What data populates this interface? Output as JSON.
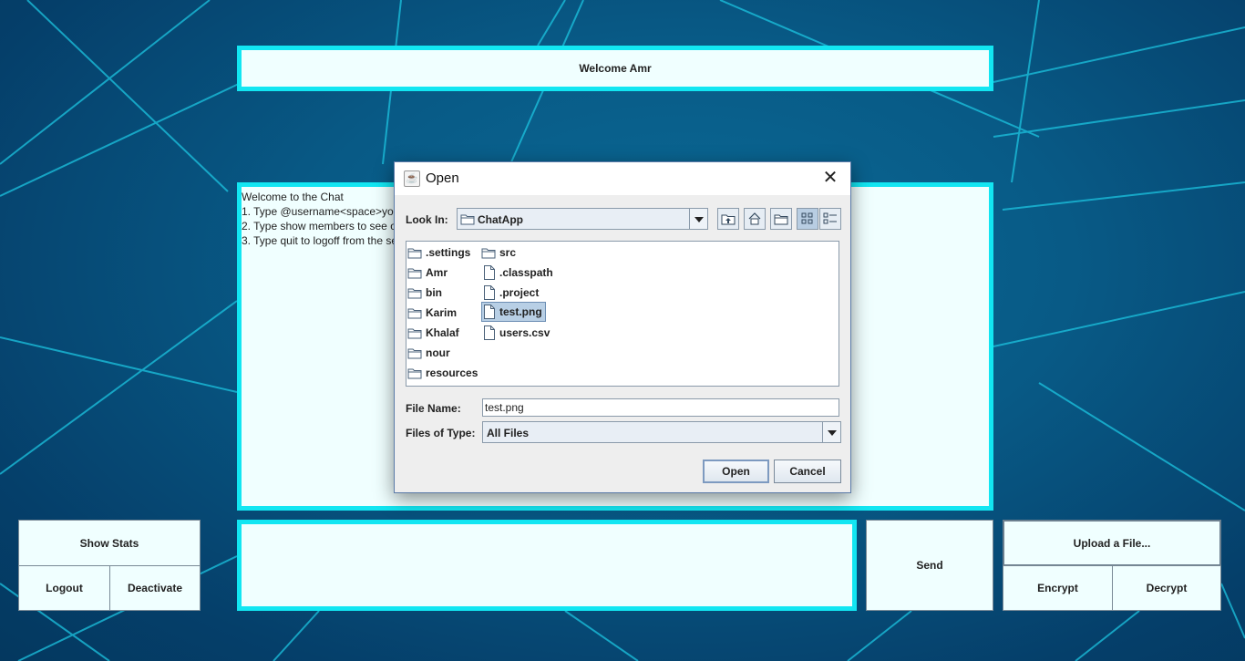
{
  "header": {
    "welcome_text": "Welcome Amr"
  },
  "chat": {
    "lines": [
      "Welcome to the Chat",
      "1. Type @username<space>your message",
      "2. Type show members to see online members",
      "3. Type quit to logoff from the server"
    ]
  },
  "left_buttons": {
    "show_stats": "Show Stats",
    "logout": "Logout",
    "deactivate": "Deactivate"
  },
  "message_input": {
    "value": ""
  },
  "send_button": "Send",
  "right_buttons": {
    "upload": "Upload a File...",
    "encrypt": "Encrypt",
    "decrypt": "Decrypt"
  },
  "dialog": {
    "title": "Open",
    "look_in_label": "Look In:",
    "look_in_value": "ChatApp",
    "folders": [
      ".settings",
      "Amr",
      "bin",
      "Karim",
      "Khalaf",
      "nour",
      "resources",
      "src"
    ],
    "files": [
      ".classpath",
      ".project",
      "test.png",
      "users.csv"
    ],
    "selected_file": "test.png",
    "file_name_label": "File Name:",
    "file_name_value": "test.png",
    "files_of_type_label": "Files of Type:",
    "files_of_type_value": "All Files",
    "open_button": "Open",
    "cancel_button": "Cancel"
  },
  "colors": {
    "panel_bg": "#f0ffff",
    "panel_border": "#12e6f2",
    "background": "#085a86",
    "selection": "#b8cfe5"
  }
}
